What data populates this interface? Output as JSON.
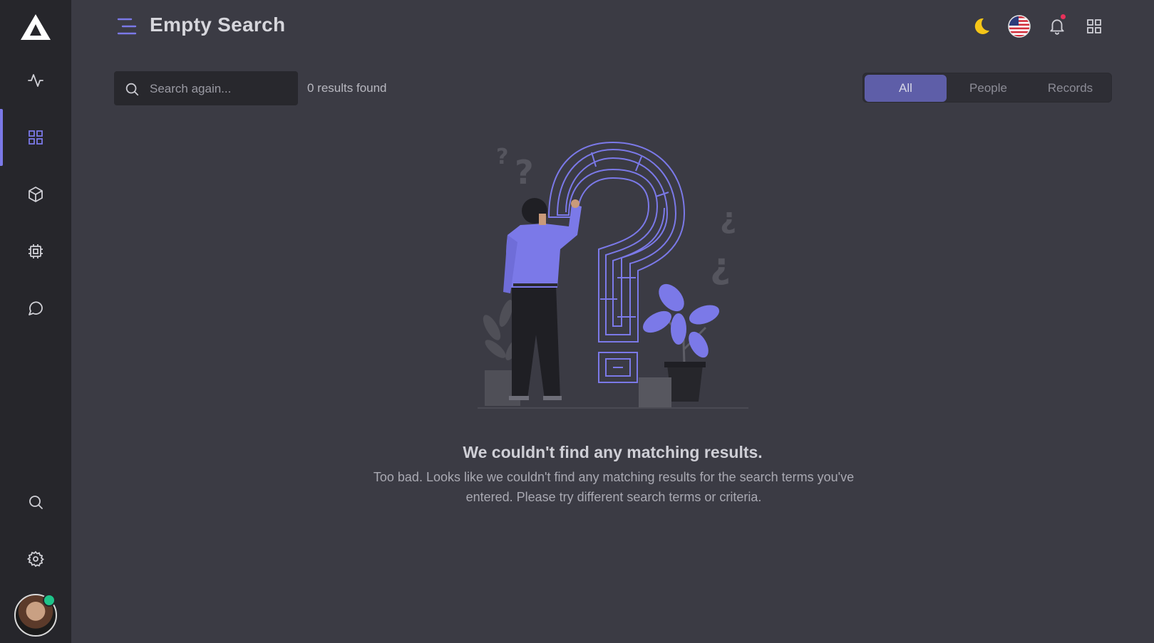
{
  "header": {
    "title": "Empty Search",
    "menu_icon": "menu-icon",
    "theme_icon": "moon-icon",
    "language_icon": "us-flag-icon",
    "notification_icon": "bell-icon",
    "apps_icon": "apps-grid-icon"
  },
  "sidebar": {
    "logo": "logo-triangle",
    "items": [
      {
        "icon": "activity-icon"
      },
      {
        "icon": "dashboard-grid-icon",
        "active": true
      },
      {
        "icon": "box-icon"
      },
      {
        "icon": "cpu-icon"
      },
      {
        "icon": "chat-icon"
      }
    ],
    "bottom_items": [
      {
        "icon": "search-icon"
      },
      {
        "icon": "settings-icon"
      }
    ],
    "avatar_status": "online"
  },
  "search": {
    "placeholder": "Search again...",
    "value": "",
    "results_text": "0 results found"
  },
  "filter_tabs": {
    "items": [
      "All",
      "People",
      "Records"
    ],
    "active": "All"
  },
  "empty_state": {
    "title": "We couldn't find any matching results.",
    "description": "Too bad. Looks like we couldn't find any matching results for the search terms you've entered. Please try different search terms or criteria."
  },
  "colors": {
    "accent": "#7b79e8",
    "background": "#3b3b44",
    "sidebar": "#26262b",
    "notification": "#e8315a",
    "online": "#1ec48a",
    "moon": "#f5c518"
  }
}
